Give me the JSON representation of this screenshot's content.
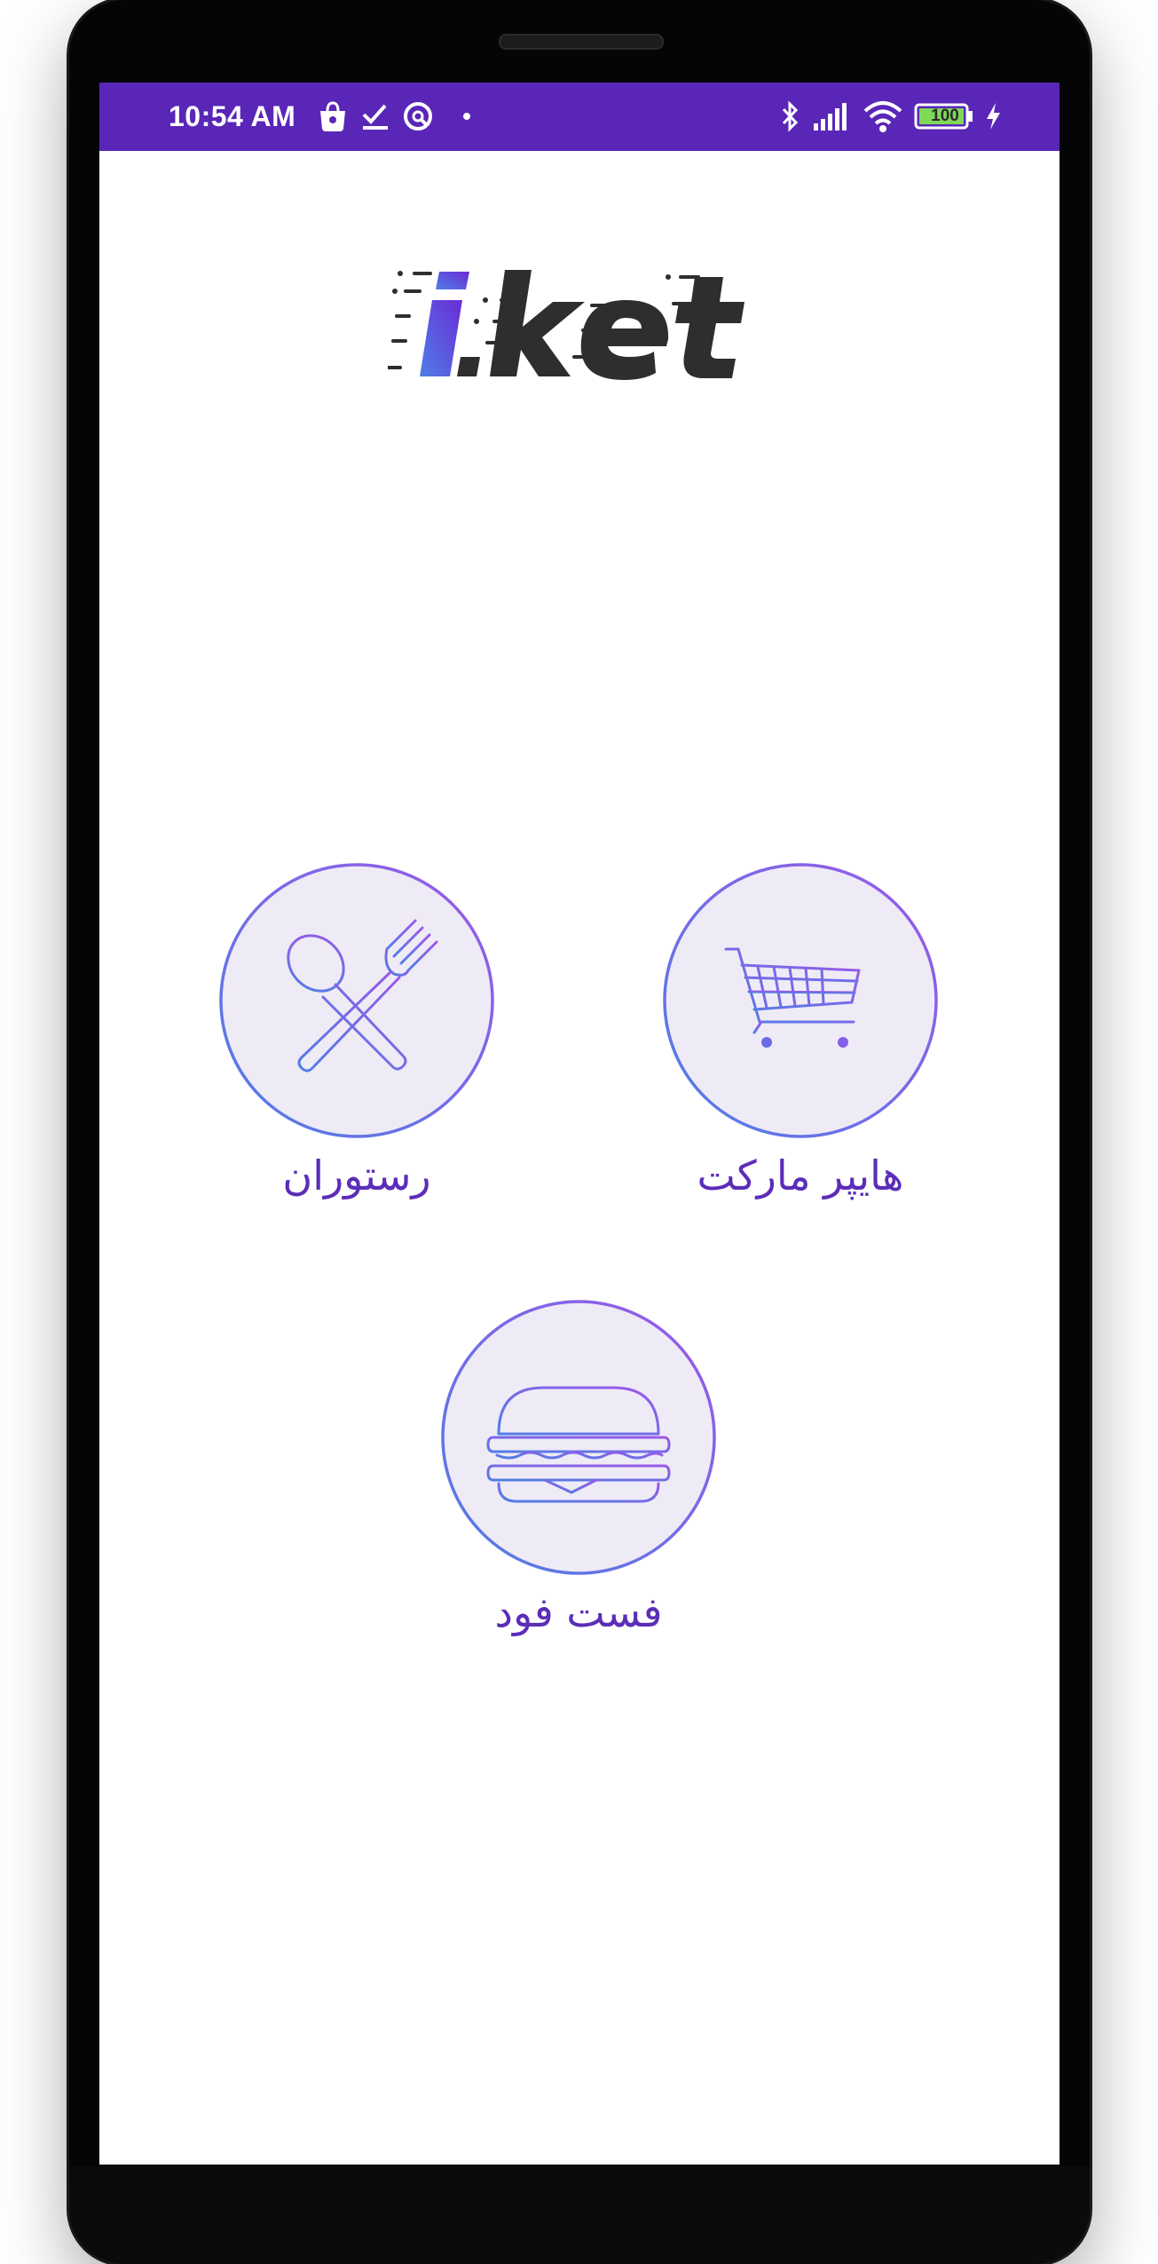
{
  "status_bar": {
    "time": "10:54 AM",
    "battery": "100",
    "background": "#5926b8"
  },
  "app": {
    "logo_text": "i.ket"
  },
  "categories": [
    {
      "id": "restaurant",
      "label": "رستوران",
      "icon": "fork-spoon-icon"
    },
    {
      "id": "hypermarket",
      "label": "هایپر مارکت",
      "icon": "shopping-cart-icon"
    },
    {
      "id": "fastfood",
      "label": "فست فود",
      "icon": "burger-icon"
    }
  ],
  "colors": {
    "accent": "#5b2db8",
    "circle_fill": "#efebf6",
    "gradient_start": "#4f7fe6",
    "gradient_end": "#9b58e8",
    "logo_dark": "#2e2d2f"
  }
}
